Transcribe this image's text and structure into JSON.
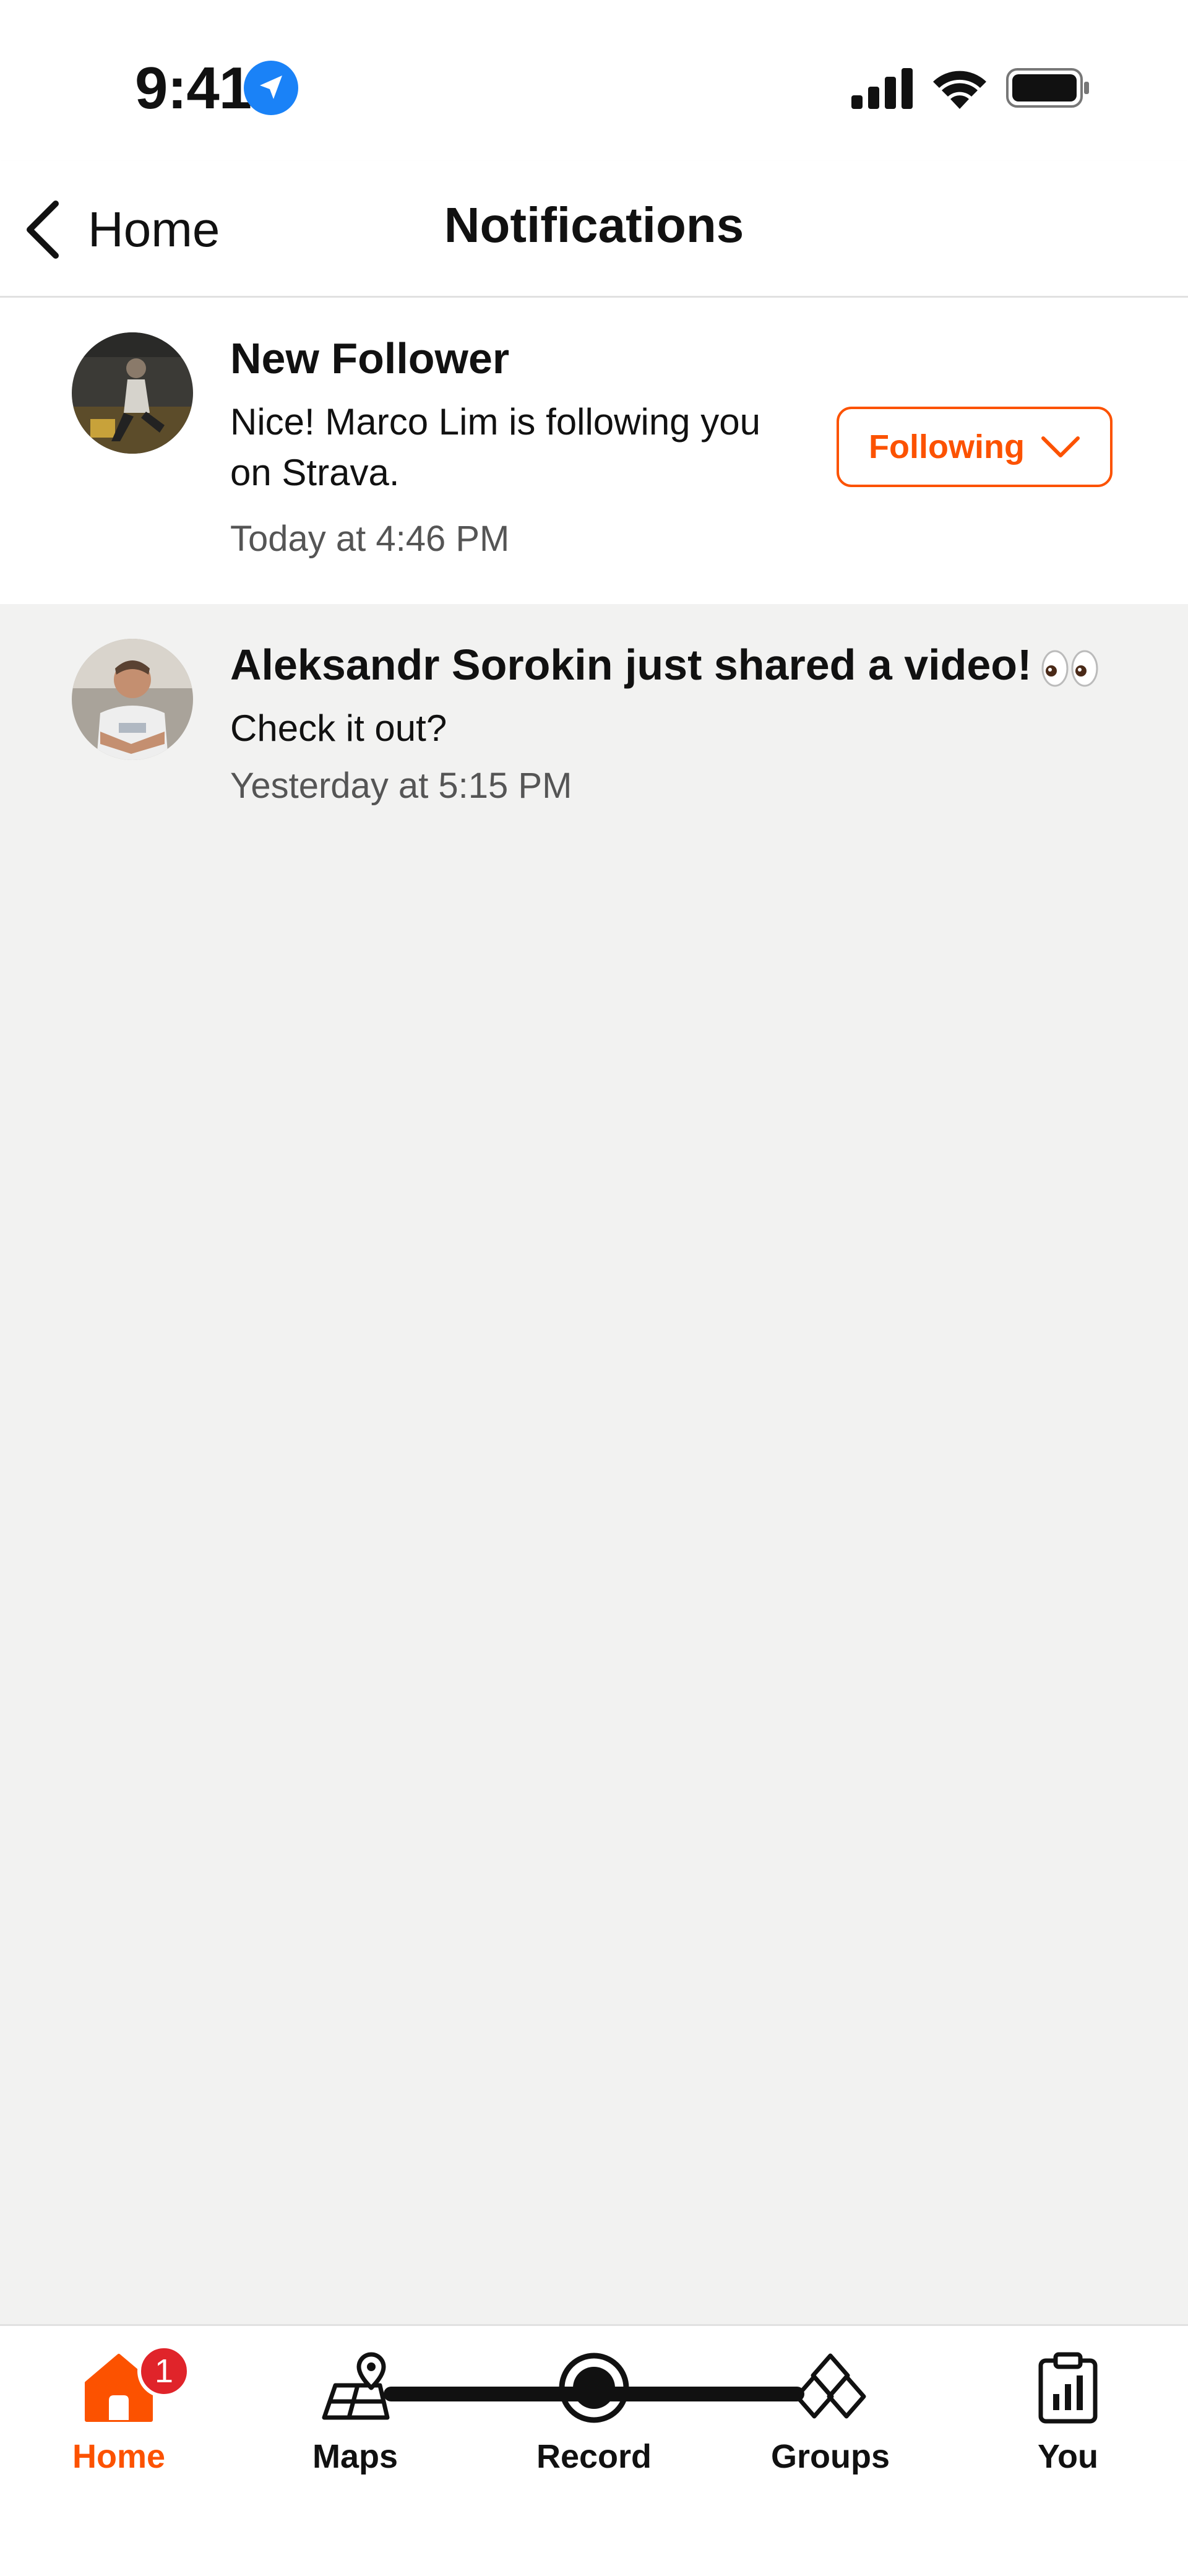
{
  "status_bar": {
    "time": "9:41"
  },
  "nav": {
    "back_label": "Home",
    "title": "Notifications"
  },
  "notifications": [
    {
      "title": "New Follower",
      "body": "Nice! Marco Lim is following you on Strava.",
      "time": "Today at 4:46 PM",
      "action_label": "Following",
      "unread": true
    },
    {
      "title": "Aleksandr Sorokin just shared a video!",
      "body": "Check it out?",
      "time": "Yesterday at 5:15 PM",
      "unread": false
    }
  ],
  "tab_bar": {
    "tabs": [
      {
        "label": "Home",
        "icon": "home-icon",
        "active": true,
        "badge": "1"
      },
      {
        "label": "Maps",
        "icon": "maps-icon",
        "active": false
      },
      {
        "label": "Record",
        "icon": "record-icon",
        "active": false
      },
      {
        "label": "Groups",
        "icon": "groups-icon",
        "active": false
      },
      {
        "label": "You",
        "icon": "you-icon",
        "active": false
      }
    ]
  },
  "colors": {
    "accent": "#fc5200",
    "badge": "#e0242a",
    "location_blue": "#1a82f7",
    "read_background": "#f2f2f1"
  }
}
